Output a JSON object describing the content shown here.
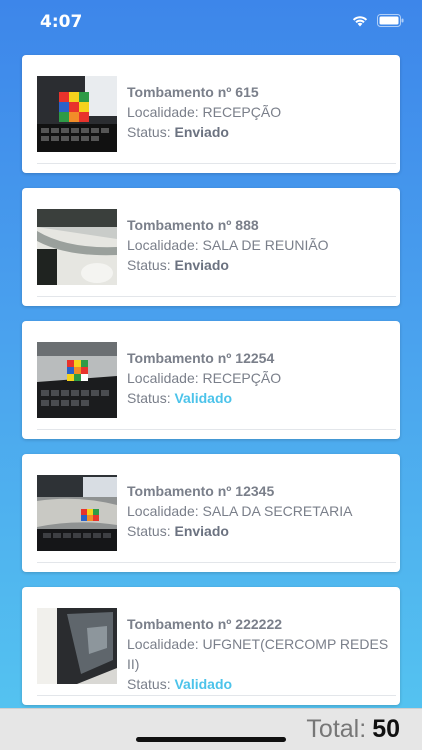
{
  "status_bar": {
    "time": "4:07"
  },
  "items": [
    {
      "title": "Tombamento nº 615",
      "locality_label": "Localidade:",
      "locality": "RECEPÇÃO",
      "status_label": "Status:",
      "status": "Enviado",
      "status_color": "#6b7280",
      "photo_icon": "rubiks-cube-photo"
    },
    {
      "title": "Tombamento nº 888",
      "locality_label": "Localidade:",
      "locality": "SALA DE REUNIÃO",
      "status_label": "Status:",
      "status": "Enviado",
      "status_color": "#6b7280",
      "photo_icon": "desk-photo"
    },
    {
      "title": "Tombamento nº 12254",
      "locality_label": "Localidade:",
      "locality": "RECEPÇÃO",
      "status_label": "Status:",
      "status": "Validado",
      "status_color": "#4cc3ea",
      "photo_icon": "rubiks-cube-photo"
    },
    {
      "title": "Tombamento nº 12345",
      "locality_label": "Localidade:",
      "locality": "SALA DA SECRETARIA",
      "status_label": "Status:",
      "status": "Enviado",
      "status_color": "#6b7280",
      "photo_icon": "rubiks-cube-photo"
    },
    {
      "title": "Tombamento nº 222222",
      "locality_label": "Localidade:",
      "locality": "UFGNET(CERCOMP REDES II)",
      "status_label": "Status:",
      "status": "Validado",
      "status_color": "#4cc3ea",
      "photo_icon": "monitor-photo"
    }
  ],
  "footer": {
    "total_label": "Total:",
    "total_value": "50"
  },
  "colors": {
    "gradient_top": "#3d86ea",
    "gradient_bottom": "#55c6f0",
    "validated": "#4cc3ea",
    "sent": "#6b7280"
  }
}
